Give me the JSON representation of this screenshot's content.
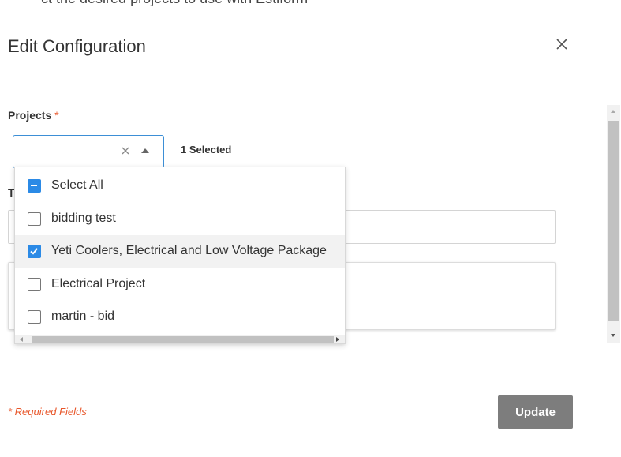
{
  "page_intro_text": "ct the desired projects to use with Estiform",
  "dialog": {
    "title": "Edit Configuration",
    "close_icon": "close-icon",
    "projects_label": "Projects",
    "required_marker": "*",
    "selected_count": "1 Selected",
    "hidden_field_label_initial": "T",
    "options": [
      {
        "label": "Select All",
        "state": "indeterminate"
      },
      {
        "label": "bidding test",
        "state": "unchecked"
      },
      {
        "label": "Yeti Coolers, Electrical and Low Voltage Package",
        "state": "checked"
      },
      {
        "label": "Electrical Project",
        "state": "unchecked"
      },
      {
        "label": "martin - bid",
        "state": "unchecked"
      }
    ],
    "required_note": "* Required Fields",
    "update_label": "Update"
  },
  "colors": {
    "accent": "#2b8ae6",
    "required": "#e8562a",
    "button": "#7d7d7d"
  }
}
